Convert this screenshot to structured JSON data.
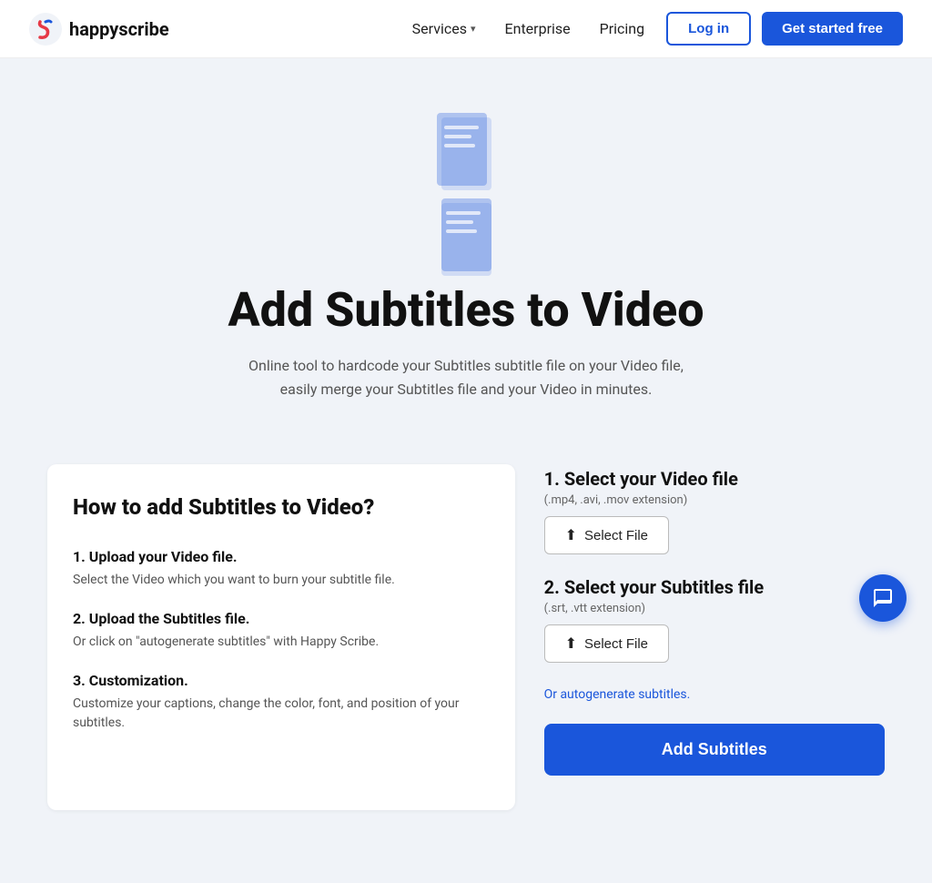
{
  "nav": {
    "logo_text": "happyscribe",
    "links": [
      {
        "label": "Services",
        "has_dropdown": true
      },
      {
        "label": "Enterprise",
        "has_dropdown": false
      },
      {
        "label": "Pricing",
        "has_dropdown": false
      }
    ],
    "login_label": "Log in",
    "get_started_label": "Get started free"
  },
  "hero": {
    "title": "Add Subtitles to Video",
    "subtitle": "Online tool to hardcode your Subtitles subtitle file on your Video file, easily merge your Subtitles file and your Video in minutes."
  },
  "how_to": {
    "heading": "How to add Subtitles to Video?",
    "steps": [
      {
        "title": "1. Upload your Video file.",
        "desc": "Select the Video which you want to burn your subtitle file."
      },
      {
        "title": "2. Upload the Subtitles file.",
        "desc": "Or click on \"autogenerate subtitles\" with Happy Scribe."
      },
      {
        "title": "3. Customization.",
        "desc": "Customize your captions, change the color, font, and position of your subtitles."
      }
    ]
  },
  "right_panel": {
    "video_section": {
      "title": "1.  Select your Video file",
      "subtitle": "(.mp4, .avi, .mov extension)",
      "button_label": "Select File"
    },
    "subtitles_section": {
      "title": "2.  Select your Subtitles file",
      "subtitle": "(.srt, .vtt extension)",
      "button_label": "Select File"
    },
    "autogenerate_label": "Or autogenerate subtitles.",
    "add_subtitles_label": "Add Subtitles"
  },
  "chat": {
    "icon_label": "chat-icon"
  }
}
